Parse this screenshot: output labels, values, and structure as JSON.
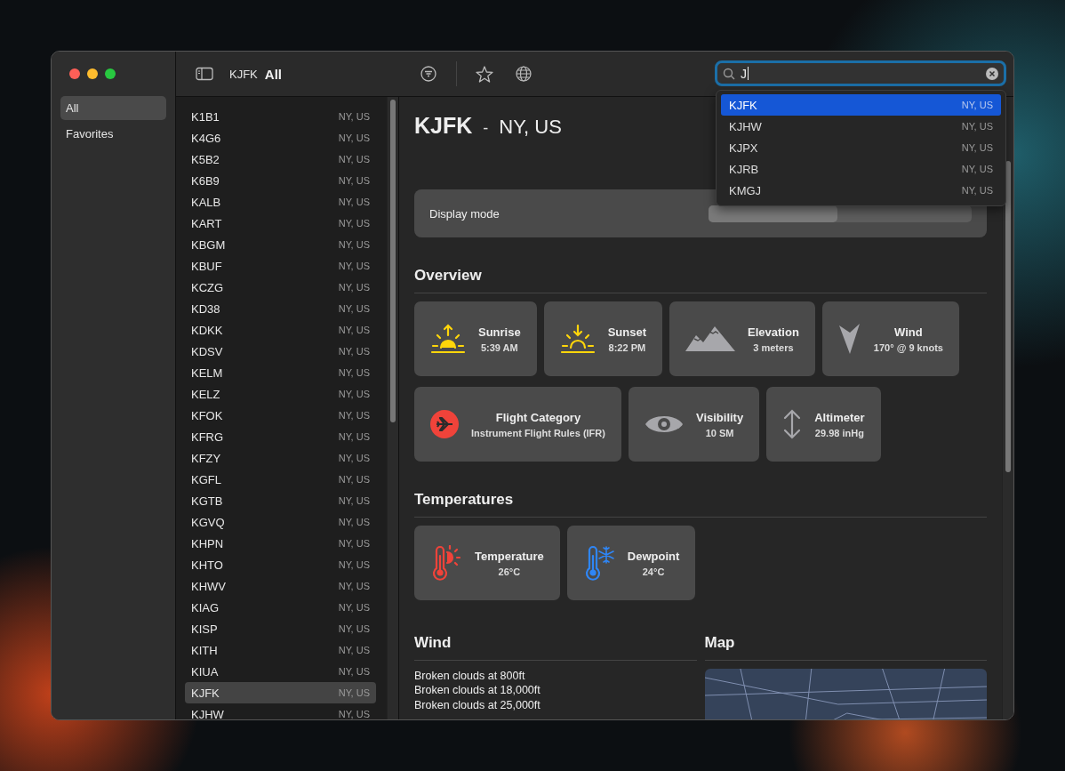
{
  "sidebar": {
    "items": [
      {
        "label": "All",
        "selected": true
      },
      {
        "label": "Favorites",
        "selected": false
      }
    ]
  },
  "toolbar": {
    "station": "KJFK",
    "filter": "All"
  },
  "search": {
    "value": "J",
    "results": [
      {
        "code": "KJFK",
        "region": "NY, US",
        "selected": true
      },
      {
        "code": "KJHW",
        "region": "NY, US",
        "selected": false
      },
      {
        "code": "KJPX",
        "region": "NY, US",
        "selected": false
      },
      {
        "code": "KJRB",
        "region": "NY, US",
        "selected": false
      },
      {
        "code": "KMGJ",
        "region": "NY, US",
        "selected": false
      }
    ]
  },
  "stations": [
    {
      "code": "K1B1",
      "region": "NY, US",
      "selected": false
    },
    {
      "code": "K4G6",
      "region": "NY, US",
      "selected": false
    },
    {
      "code": "K5B2",
      "region": "NY, US",
      "selected": false
    },
    {
      "code": "K6B9",
      "region": "NY, US",
      "selected": false
    },
    {
      "code": "KALB",
      "region": "NY, US",
      "selected": false
    },
    {
      "code": "KART",
      "region": "NY, US",
      "selected": false
    },
    {
      "code": "KBGM",
      "region": "NY, US",
      "selected": false
    },
    {
      "code": "KBUF",
      "region": "NY, US",
      "selected": false
    },
    {
      "code": "KCZG",
      "region": "NY, US",
      "selected": false
    },
    {
      "code": "KD38",
      "region": "NY, US",
      "selected": false
    },
    {
      "code": "KDKK",
      "region": "NY, US",
      "selected": false
    },
    {
      "code": "KDSV",
      "region": "NY, US",
      "selected": false
    },
    {
      "code": "KELM",
      "region": "NY, US",
      "selected": false
    },
    {
      "code": "KELZ",
      "region": "NY, US",
      "selected": false
    },
    {
      "code": "KFOK",
      "region": "NY, US",
      "selected": false
    },
    {
      "code": "KFRG",
      "region": "NY, US",
      "selected": false
    },
    {
      "code": "KFZY",
      "region": "NY, US",
      "selected": false
    },
    {
      "code": "KGFL",
      "region": "NY, US",
      "selected": false
    },
    {
      "code": "KGTB",
      "region": "NY, US",
      "selected": false
    },
    {
      "code": "KGVQ",
      "region": "NY, US",
      "selected": false
    },
    {
      "code": "KHPN",
      "region": "NY, US",
      "selected": false
    },
    {
      "code": "KHTO",
      "region": "NY, US",
      "selected": false
    },
    {
      "code": "KHWV",
      "region": "NY, US",
      "selected": false
    },
    {
      "code": "KIAG",
      "region": "NY, US",
      "selected": false
    },
    {
      "code": "KISP",
      "region": "NY, US",
      "selected": false
    },
    {
      "code": "KITH",
      "region": "NY, US",
      "selected": false
    },
    {
      "code": "KIUA",
      "region": "NY, US",
      "selected": false
    },
    {
      "code": "KJFK",
      "region": "NY, US",
      "selected": true
    },
    {
      "code": "KJHW",
      "region": "NY, US",
      "selected": false
    }
  ],
  "detail": {
    "code": "KJFK",
    "separator": "-",
    "region": "NY, US",
    "display_mode": {
      "label": "Display mode"
    },
    "overview": {
      "heading": "Overview",
      "rows": [
        [
          {
            "kind": "sunrise",
            "label": "Sunrise",
            "value": "5:39 AM"
          },
          {
            "kind": "sunset",
            "label": "Sunset",
            "value": "8:22 PM"
          },
          {
            "kind": "elevation",
            "label": "Elevation",
            "value": "3 meters"
          },
          {
            "kind": "wind",
            "label": "Wind",
            "value": "170° @ 9 knots"
          }
        ],
        [
          {
            "kind": "flight",
            "label": "Flight Category",
            "value": "Instrument Flight Rules (IFR)",
            "color": "#f0433a"
          },
          {
            "kind": "visibility",
            "label": "Visibility",
            "value": "10 SM"
          },
          {
            "kind": "altimeter",
            "label": "Altimeter",
            "value": "29.98 inHg"
          }
        ]
      ]
    },
    "temperatures": {
      "heading": "Temperatures",
      "cards": [
        {
          "kind": "temperature",
          "label": "Temperature",
          "value": "26°C"
        },
        {
          "kind": "dewpoint",
          "label": "Dewpoint",
          "value": "24°C"
        }
      ]
    },
    "wind": {
      "heading": "Wind",
      "lines": [
        "Broken clouds at 800ft",
        "Broken clouds at 18,000ft",
        "Broken clouds at 25,000ft"
      ]
    },
    "map": {
      "heading": "Map"
    }
  }
}
